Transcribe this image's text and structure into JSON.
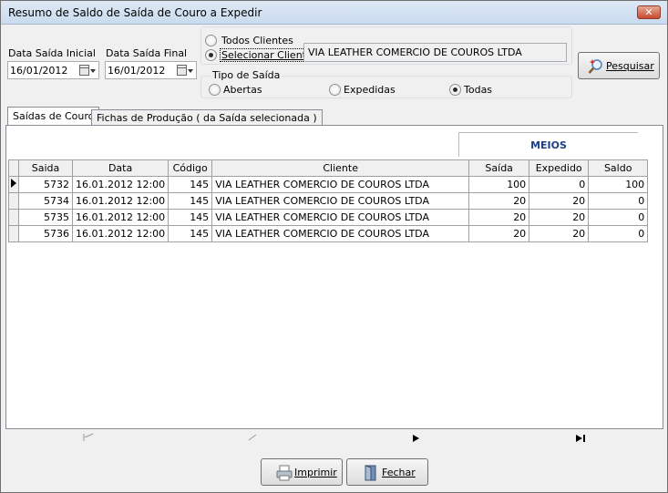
{
  "window": {
    "title": "Resumo de Saldo de Saída de Couro a Expedir",
    "close_label": "✕"
  },
  "filters": {
    "data_inicial_label": "Data Saída Inicial",
    "data_inicial_value": "16/01/2012",
    "data_final_label": "Data Saída Final",
    "data_final_value": "16/01/2012",
    "todos_clientes_label": "Todos Clientes",
    "selecionar_cliente_label": "Selecionar Cliente",
    "cliente_value": "VIA LEATHER COMERCIO DE COUROS LTDA",
    "tipo_saida_label": "Tipo de Saída",
    "abertas_label": "Abertas",
    "expedidas_label": "Expedidas",
    "todas_label": "Todas",
    "pesquisar_label": "Pesquisar"
  },
  "tabs": [
    {
      "label": "Saídas de Couro"
    },
    {
      "label": "Fichas de Produção ( da Saída selecionada )"
    }
  ],
  "grid": {
    "group_header": "MEIOS",
    "columns": [
      "Saida",
      "Data",
      "Código",
      "Cliente",
      "Saída",
      "Expedido",
      "Saldo"
    ],
    "rows": [
      {
        "saida": "5732",
        "data": "16.01.2012 12:00",
        "codigo": "145",
        "cliente": "VIA LEATHER COMERCIO DE COUROS LTDA",
        "meios_saida": "100",
        "expedido": "0",
        "saldo": "100"
      },
      {
        "saida": "5734",
        "data": "16.01.2012 12:00",
        "codigo": "145",
        "cliente": "VIA LEATHER COMERCIO DE COUROS LTDA",
        "meios_saida": "20",
        "expedido": "20",
        "saldo": "0"
      },
      {
        "saida": "5735",
        "data": "16.01.2012 12:00",
        "codigo": "145",
        "cliente": "VIA LEATHER COMERCIO DE COUROS LTDA",
        "meios_saida": "20",
        "expedido": "20",
        "saldo": "0"
      },
      {
        "saida": "5736",
        "data": "16.01.2012 12:00",
        "codigo": "145",
        "cliente": "VIA LEATHER COMERCIO DE COUROS LTDA",
        "meios_saida": "20",
        "expedido": "20",
        "saldo": "0"
      }
    ]
  },
  "footer": {
    "imprimir_label": "Imprimir",
    "fechar_label": "Fechar"
  }
}
